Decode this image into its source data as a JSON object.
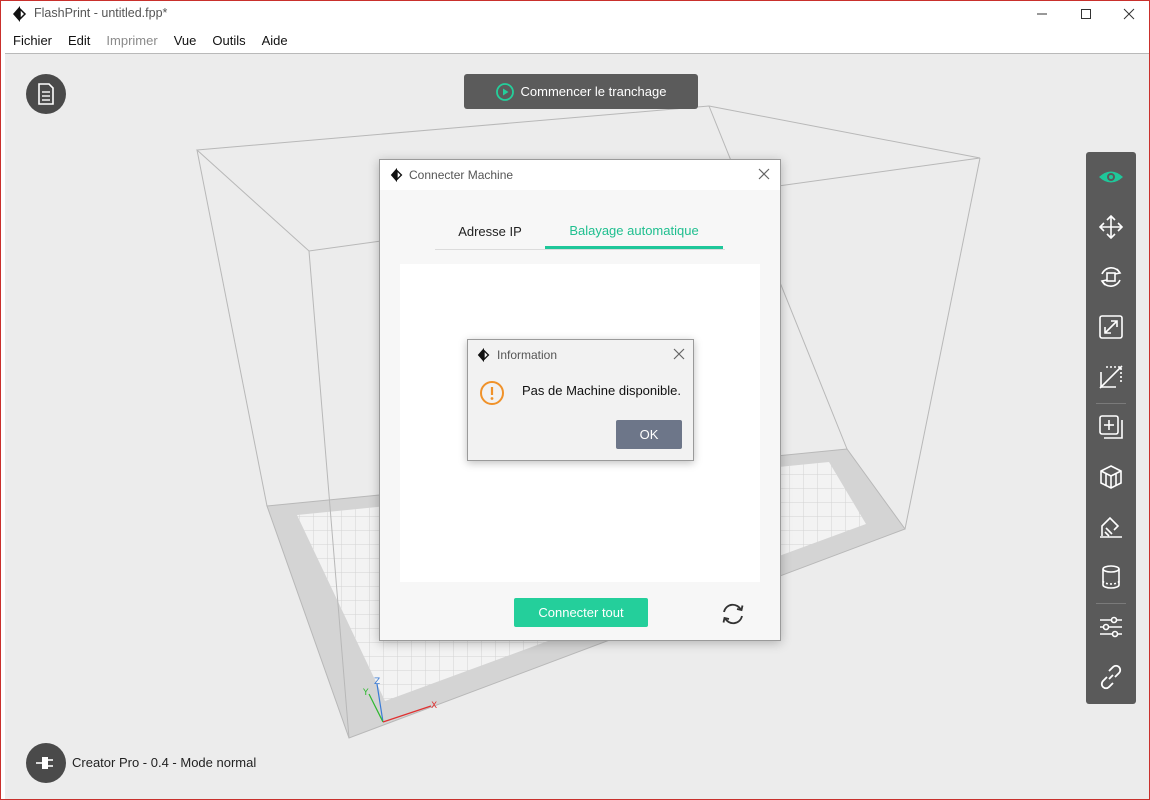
{
  "window": {
    "title": "FlashPrint - untitled.fpp*",
    "controls": [
      "minimize-icon",
      "maximize-icon",
      "close-icon"
    ]
  },
  "menu": {
    "items": [
      {
        "label": "Fichier",
        "enabled": true
      },
      {
        "label": "Edit",
        "enabled": true
      },
      {
        "label": "Imprimer",
        "enabled": false
      },
      {
        "label": "Vue",
        "enabled": true
      },
      {
        "label": "Outils",
        "enabled": true
      },
      {
        "label": "Aide",
        "enabled": true
      }
    ]
  },
  "viewport": {
    "slice_button": "Commencer le tranchage",
    "status_text": "Creator Pro - 0.4 - Mode normal",
    "axes": {
      "z": "Z",
      "y": "Y",
      "x": "X"
    }
  },
  "toolbar": {
    "tools": [
      "view-icon",
      "move-icon",
      "rotate-icon",
      "scale-icon",
      "cut-icon",
      "add-icon",
      "supports-icon",
      "extruder-icon",
      "raft-icon",
      "settings-icon",
      "connect-icon"
    ]
  },
  "connect_dialog": {
    "title": "Connecter Machine",
    "tabs": [
      {
        "label": "Adresse IP",
        "active": false
      },
      {
        "label": "Balayage automatique",
        "active": true
      }
    ],
    "connect_all": "Connecter tout"
  },
  "info_dialog": {
    "title": "Information",
    "message": "Pas de Machine disponible.",
    "ok": "OK"
  },
  "colors": {
    "accent": "#1fc79a",
    "toolbar_bg": "#5a5a5a",
    "warning": "#f0922a",
    "ok_button": "#6d7689"
  }
}
